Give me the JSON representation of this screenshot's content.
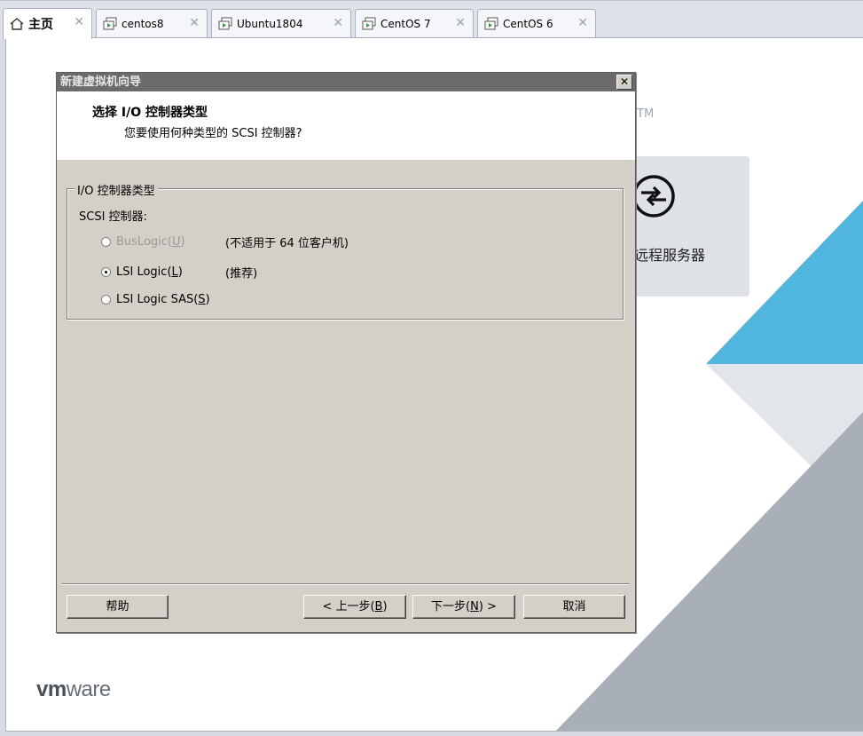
{
  "tabs": [
    {
      "label": "主页",
      "icon": "home-icon",
      "active": true
    },
    {
      "label": "centos8",
      "icon": "vm-icon"
    },
    {
      "label": "Ubuntu1804",
      "icon": "vm-icon"
    },
    {
      "label": "CentOS 7",
      "icon": "vm-icon"
    },
    {
      "label": "CentOS 6",
      "icon": "vm-icon"
    }
  ],
  "background": {
    "tm": "TM",
    "remote_server_label": "远程服务器",
    "logo_bold": "vm",
    "logo_rest": "ware"
  },
  "dialog": {
    "title": "新建虚拟机向导",
    "close_glyph": "✕",
    "header_title": "选择 I/O 控制器类型",
    "header_subtitle": "您要使用何种类型的 SCSI 控制器?",
    "group_label": "I/O 控制器类型",
    "scsi_label": "SCSI 控制器:",
    "options": [
      {
        "label_pre": "BusLogic(",
        "accel": "U",
        "label_post": ")",
        "note": "(不适用于 64 位客户机)",
        "checked": false,
        "disabled": true
      },
      {
        "label_pre": "LSI Logic(",
        "accel": "L",
        "label_post": ")",
        "note": "(推荐)",
        "checked": true,
        "disabled": false
      },
      {
        "label_pre": "LSI Logic SAS(",
        "accel": "S",
        "label_post": ")",
        "note": "",
        "checked": false,
        "disabled": false
      }
    ],
    "buttons": {
      "help": "帮助",
      "back_pre": "< 上一步(",
      "back_accel": "B",
      "back_post": ")",
      "next_pre": "下一步(",
      "next_accel": "N",
      "next_post": ") >",
      "cancel": "取消"
    }
  },
  "colors": {
    "tri_light": "#51b6dd",
    "tri_mid": "#dfe3e8",
    "tri_dark": "#a8afb8",
    "dialog_bg": "#d4d0c8"
  }
}
